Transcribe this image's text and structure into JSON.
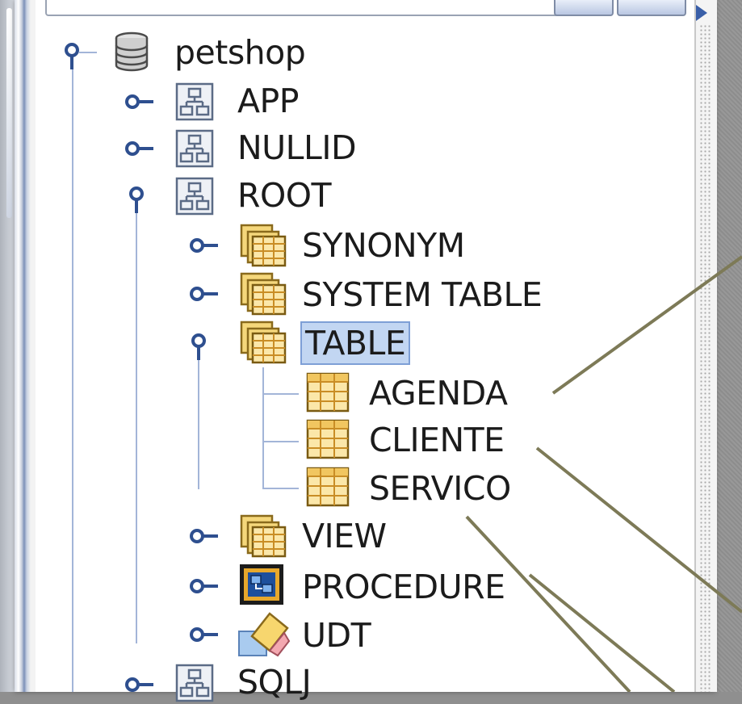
{
  "tree": {
    "root": {
      "label": "petshop",
      "icon": "database-icon",
      "expanded": true
    },
    "schemas": [
      {
        "label": "APP",
        "icon": "schema-icon",
        "expanded": false
      },
      {
        "label": "NULLID",
        "icon": "schema-icon",
        "expanded": false
      },
      {
        "label": "ROOT",
        "icon": "schema-icon",
        "expanded": true
      },
      {
        "label": "SQLJ",
        "icon": "schema-icon",
        "expanded": false
      }
    ],
    "root_children": [
      {
        "label": "SYNONYM",
        "icon": "table-folder-icon",
        "expanded": false
      },
      {
        "label": "SYSTEM TABLE",
        "icon": "table-folder-icon",
        "expanded": false
      },
      {
        "label": "TABLE",
        "icon": "table-folder-icon",
        "expanded": true,
        "selected": true
      },
      {
        "label": "VIEW",
        "icon": "table-folder-icon",
        "expanded": false
      },
      {
        "label": "PROCEDURE",
        "icon": "procedure-icon",
        "expanded": false
      },
      {
        "label": "UDT",
        "icon": "udt-icon",
        "expanded": false
      }
    ],
    "tables": [
      {
        "label": "AGENDA",
        "icon": "table-icon"
      },
      {
        "label": "CLIENTE",
        "icon": "table-icon"
      },
      {
        "label": "SERVICO",
        "icon": "table-icon"
      }
    ]
  },
  "colors": {
    "tree_line": "#a3b5d8",
    "selection": "#c2d6f2",
    "callout_line": "#7d7a57"
  }
}
